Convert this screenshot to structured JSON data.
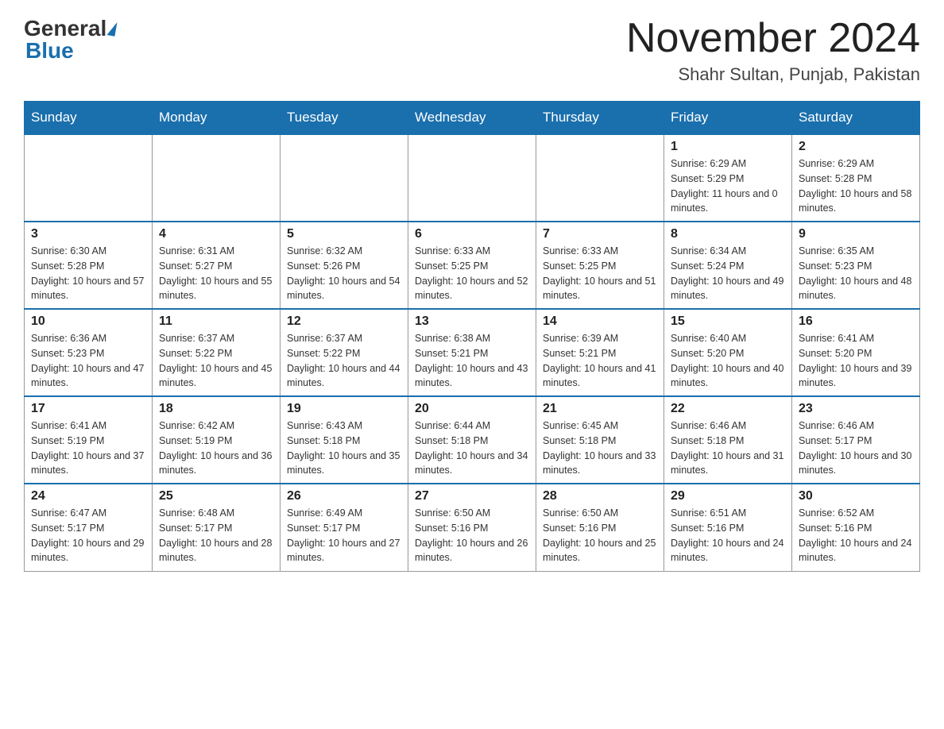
{
  "logo": {
    "general": "General",
    "blue": "Blue"
  },
  "title": {
    "month_year": "November 2024",
    "location": "Shahr Sultan, Punjab, Pakistan"
  },
  "days_of_week": [
    "Sunday",
    "Monday",
    "Tuesday",
    "Wednesday",
    "Thursday",
    "Friday",
    "Saturday"
  ],
  "weeks": [
    [
      {
        "day": "",
        "sunrise": "",
        "sunset": "",
        "daylight": ""
      },
      {
        "day": "",
        "sunrise": "",
        "sunset": "",
        "daylight": ""
      },
      {
        "day": "",
        "sunrise": "",
        "sunset": "",
        "daylight": ""
      },
      {
        "day": "",
        "sunrise": "",
        "sunset": "",
        "daylight": ""
      },
      {
        "day": "",
        "sunrise": "",
        "sunset": "",
        "daylight": ""
      },
      {
        "day": "1",
        "sunrise": "Sunrise: 6:29 AM",
        "sunset": "Sunset: 5:29 PM",
        "daylight": "Daylight: 11 hours and 0 minutes."
      },
      {
        "day": "2",
        "sunrise": "Sunrise: 6:29 AM",
        "sunset": "Sunset: 5:28 PM",
        "daylight": "Daylight: 10 hours and 58 minutes."
      }
    ],
    [
      {
        "day": "3",
        "sunrise": "Sunrise: 6:30 AM",
        "sunset": "Sunset: 5:28 PM",
        "daylight": "Daylight: 10 hours and 57 minutes."
      },
      {
        "day": "4",
        "sunrise": "Sunrise: 6:31 AM",
        "sunset": "Sunset: 5:27 PM",
        "daylight": "Daylight: 10 hours and 55 minutes."
      },
      {
        "day": "5",
        "sunrise": "Sunrise: 6:32 AM",
        "sunset": "Sunset: 5:26 PM",
        "daylight": "Daylight: 10 hours and 54 minutes."
      },
      {
        "day": "6",
        "sunrise": "Sunrise: 6:33 AM",
        "sunset": "Sunset: 5:25 PM",
        "daylight": "Daylight: 10 hours and 52 minutes."
      },
      {
        "day": "7",
        "sunrise": "Sunrise: 6:33 AM",
        "sunset": "Sunset: 5:25 PM",
        "daylight": "Daylight: 10 hours and 51 minutes."
      },
      {
        "day": "8",
        "sunrise": "Sunrise: 6:34 AM",
        "sunset": "Sunset: 5:24 PM",
        "daylight": "Daylight: 10 hours and 49 minutes."
      },
      {
        "day": "9",
        "sunrise": "Sunrise: 6:35 AM",
        "sunset": "Sunset: 5:23 PM",
        "daylight": "Daylight: 10 hours and 48 minutes."
      }
    ],
    [
      {
        "day": "10",
        "sunrise": "Sunrise: 6:36 AM",
        "sunset": "Sunset: 5:23 PM",
        "daylight": "Daylight: 10 hours and 47 minutes."
      },
      {
        "day": "11",
        "sunrise": "Sunrise: 6:37 AM",
        "sunset": "Sunset: 5:22 PM",
        "daylight": "Daylight: 10 hours and 45 minutes."
      },
      {
        "day": "12",
        "sunrise": "Sunrise: 6:37 AM",
        "sunset": "Sunset: 5:22 PM",
        "daylight": "Daylight: 10 hours and 44 minutes."
      },
      {
        "day": "13",
        "sunrise": "Sunrise: 6:38 AM",
        "sunset": "Sunset: 5:21 PM",
        "daylight": "Daylight: 10 hours and 43 minutes."
      },
      {
        "day": "14",
        "sunrise": "Sunrise: 6:39 AM",
        "sunset": "Sunset: 5:21 PM",
        "daylight": "Daylight: 10 hours and 41 minutes."
      },
      {
        "day": "15",
        "sunrise": "Sunrise: 6:40 AM",
        "sunset": "Sunset: 5:20 PM",
        "daylight": "Daylight: 10 hours and 40 minutes."
      },
      {
        "day": "16",
        "sunrise": "Sunrise: 6:41 AM",
        "sunset": "Sunset: 5:20 PM",
        "daylight": "Daylight: 10 hours and 39 minutes."
      }
    ],
    [
      {
        "day": "17",
        "sunrise": "Sunrise: 6:41 AM",
        "sunset": "Sunset: 5:19 PM",
        "daylight": "Daylight: 10 hours and 37 minutes."
      },
      {
        "day": "18",
        "sunrise": "Sunrise: 6:42 AM",
        "sunset": "Sunset: 5:19 PM",
        "daylight": "Daylight: 10 hours and 36 minutes."
      },
      {
        "day": "19",
        "sunrise": "Sunrise: 6:43 AM",
        "sunset": "Sunset: 5:18 PM",
        "daylight": "Daylight: 10 hours and 35 minutes."
      },
      {
        "day": "20",
        "sunrise": "Sunrise: 6:44 AM",
        "sunset": "Sunset: 5:18 PM",
        "daylight": "Daylight: 10 hours and 34 minutes."
      },
      {
        "day": "21",
        "sunrise": "Sunrise: 6:45 AM",
        "sunset": "Sunset: 5:18 PM",
        "daylight": "Daylight: 10 hours and 33 minutes."
      },
      {
        "day": "22",
        "sunrise": "Sunrise: 6:46 AM",
        "sunset": "Sunset: 5:18 PM",
        "daylight": "Daylight: 10 hours and 31 minutes."
      },
      {
        "day": "23",
        "sunrise": "Sunrise: 6:46 AM",
        "sunset": "Sunset: 5:17 PM",
        "daylight": "Daylight: 10 hours and 30 minutes."
      }
    ],
    [
      {
        "day": "24",
        "sunrise": "Sunrise: 6:47 AM",
        "sunset": "Sunset: 5:17 PM",
        "daylight": "Daylight: 10 hours and 29 minutes."
      },
      {
        "day": "25",
        "sunrise": "Sunrise: 6:48 AM",
        "sunset": "Sunset: 5:17 PM",
        "daylight": "Daylight: 10 hours and 28 minutes."
      },
      {
        "day": "26",
        "sunrise": "Sunrise: 6:49 AM",
        "sunset": "Sunset: 5:17 PM",
        "daylight": "Daylight: 10 hours and 27 minutes."
      },
      {
        "day": "27",
        "sunrise": "Sunrise: 6:50 AM",
        "sunset": "Sunset: 5:16 PM",
        "daylight": "Daylight: 10 hours and 26 minutes."
      },
      {
        "day": "28",
        "sunrise": "Sunrise: 6:50 AM",
        "sunset": "Sunset: 5:16 PM",
        "daylight": "Daylight: 10 hours and 25 minutes."
      },
      {
        "day": "29",
        "sunrise": "Sunrise: 6:51 AM",
        "sunset": "Sunset: 5:16 PM",
        "daylight": "Daylight: 10 hours and 24 minutes."
      },
      {
        "day": "30",
        "sunrise": "Sunrise: 6:52 AM",
        "sunset": "Sunset: 5:16 PM",
        "daylight": "Daylight: 10 hours and 24 minutes."
      }
    ]
  ]
}
